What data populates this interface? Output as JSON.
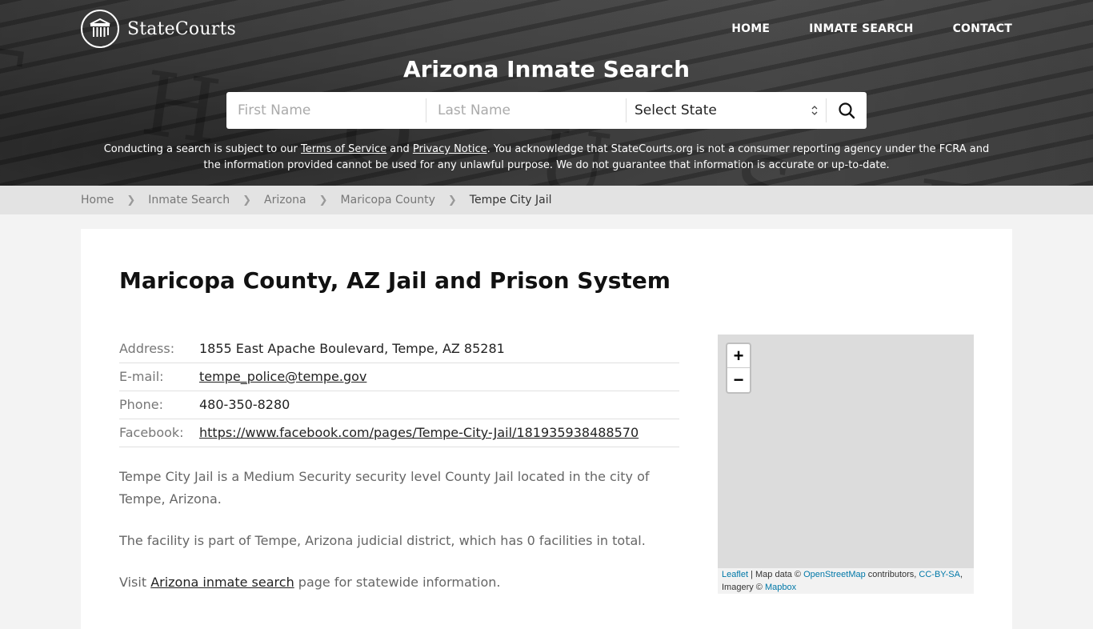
{
  "header": {
    "logo_text": "StateCourts",
    "nav": [
      {
        "label": "HOME"
      },
      {
        "label": "INMATE SEARCH"
      },
      {
        "label": "CONTACT"
      }
    ],
    "hero_title": "Arizona Inmate Search",
    "hero_letters": "R T   H O U S E"
  },
  "search": {
    "first_name_placeholder": "First Name",
    "last_name_placeholder": "Last Name",
    "state_select": "Select State",
    "search_icon": "search-icon"
  },
  "disclaimer": {
    "part1": "Conducting a search is subject to our ",
    "terms_link": "Terms of Service",
    "part2": " and ",
    "privacy_link": "Privacy Notice",
    "part3": ". You acknowledge that StateCourts.org is not a consumer reporting agency under the FCRA and the information provided cannot be used for any unlawful purpose. We do not guarantee that information is accurate or up-to-date."
  },
  "breadcrumb": [
    {
      "label": "Home"
    },
    {
      "label": "Inmate Search"
    },
    {
      "label": "Arizona"
    },
    {
      "label": "Maricopa County"
    },
    {
      "label": "Tempe City Jail"
    }
  ],
  "main": {
    "title": "Maricopa County, AZ Jail and Prison System",
    "info": {
      "address_label": "Address:",
      "address": "1855 East Apache Boulevard, Tempe, AZ 85281",
      "email_label": "E-mail:",
      "email": "tempe_police@tempe.gov",
      "phone_label": "Phone:",
      "phone": "480-350-8280",
      "facebook_label": "Facebook:",
      "facebook": "https://www.facebook.com/pages/Tempe-City-Jail/181935938488570"
    },
    "paragraphs": {
      "p1": "Tempe City Jail is a Medium Security security level County Jail located in the city of Tempe, Arizona.",
      "p2": "The facility is part of Tempe, Arizona judicial district, which has 0 facilities in total.",
      "p3_prefix": "Visit ",
      "p3_link": "Arizona inmate search",
      "p3_suffix": " page for statewide information."
    }
  },
  "map": {
    "zoom_in": "+",
    "zoom_out": "−",
    "attribution": {
      "leaflet": "Leaflet",
      "sep": " | Map data © ",
      "osm": "OpenStreetMap",
      "contrib": " contributors, ",
      "license": "CC-BY-SA",
      "imagery": ", Imagery © ",
      "mapbox": "Mapbox"
    }
  },
  "colors": {
    "link_blue": "#0078a8",
    "crumb_bg": "#e3e3e3",
    "page_bg": "#f3f3f3"
  }
}
